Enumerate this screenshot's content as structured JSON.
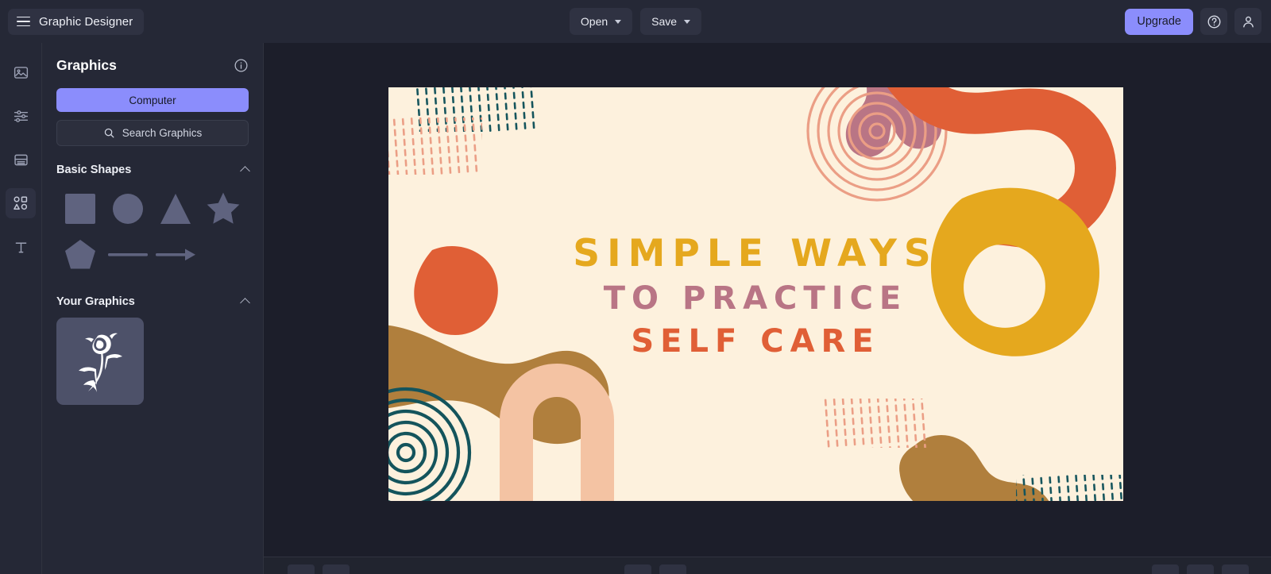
{
  "app": {
    "title": "Graphic Designer",
    "menu_icon": "hamburger-icon"
  },
  "topbar": {
    "open_label": "Open",
    "save_label": "Save",
    "upgrade_label": "Upgrade",
    "help_icon": "help-circle-icon",
    "account_icon": "user-icon"
  },
  "rail": {
    "items": [
      {
        "name": "image-icon",
        "label": "Image",
        "active": false
      },
      {
        "name": "adjustments-icon",
        "label": "Adjustments",
        "active": false
      },
      {
        "name": "layout-icon",
        "label": "Layout",
        "active": false
      },
      {
        "name": "shapes-icon",
        "label": "Graphics",
        "active": true
      },
      {
        "name": "text-icon",
        "label": "Text",
        "active": false
      }
    ]
  },
  "panel": {
    "title": "Graphics",
    "info_icon": "info-icon",
    "source_button": "Computer",
    "search_label": "Search Graphics",
    "search_icon": "search-icon",
    "sections": [
      {
        "title": "Basic Shapes",
        "collapse_icon": "chevron-up-icon"
      },
      {
        "title": "Your Graphics",
        "collapse_icon": "chevron-up-icon"
      }
    ],
    "shapes": [
      "square-shape",
      "circle-shape",
      "triangle-shape",
      "star-shape",
      "pentagon-shape",
      "line-shape",
      "arrow-shape"
    ],
    "your_graphics": [
      {
        "name": "rose-graphic-thumbnail"
      }
    ]
  },
  "canvas": {
    "background": "#fdf1dd",
    "headline": {
      "line1": "SIMPLE WAYS",
      "line2": "TO PRACTICE",
      "line3": "SELF CARE",
      "line1_color": "#e5a81e",
      "line2_color": "#b97585",
      "line3_color": "#e05f36"
    },
    "palette": {
      "cream": "#fdf1dd",
      "rose": "#b97585",
      "orange": "#e05f36",
      "gold": "#e5a81e",
      "brown": "#b07f3d",
      "peach": "#f4c3a3",
      "teal": "#14545c",
      "salmon": "#eb9e85"
    }
  }
}
